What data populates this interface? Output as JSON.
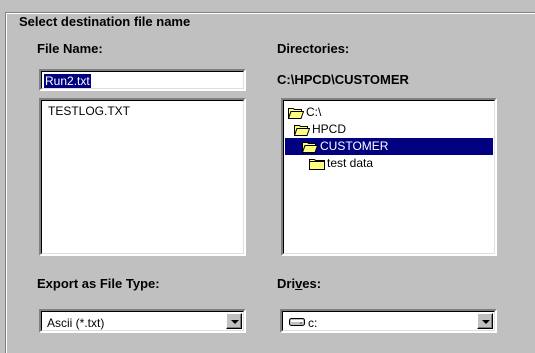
{
  "group": {
    "title": "Select destination file name"
  },
  "file_name": {
    "label": "File Name:",
    "value": "Run2.txt"
  },
  "files": {
    "items": [
      "TESTLOG.TXT"
    ]
  },
  "directories": {
    "label": "Directories:",
    "current_path": "C:\\HPCD\\CUSTOMER",
    "items": [
      {
        "label": "C:\\",
        "state": "open"
      },
      {
        "label": "HPCD",
        "state": "open"
      },
      {
        "label": "CUSTOMER",
        "state": "open",
        "selected": true
      },
      {
        "label": "test data",
        "state": "closed"
      }
    ]
  },
  "export_type": {
    "label": "Export as File Type:",
    "value": "Ascii  (*.txt)"
  },
  "drives": {
    "label_before": "Dri",
    "label_underlined": "v",
    "label_after": "es:",
    "value": "c:"
  },
  "colors": {
    "face": "#c0c0c0",
    "selection": "#000080",
    "folder": "#ffff80"
  }
}
